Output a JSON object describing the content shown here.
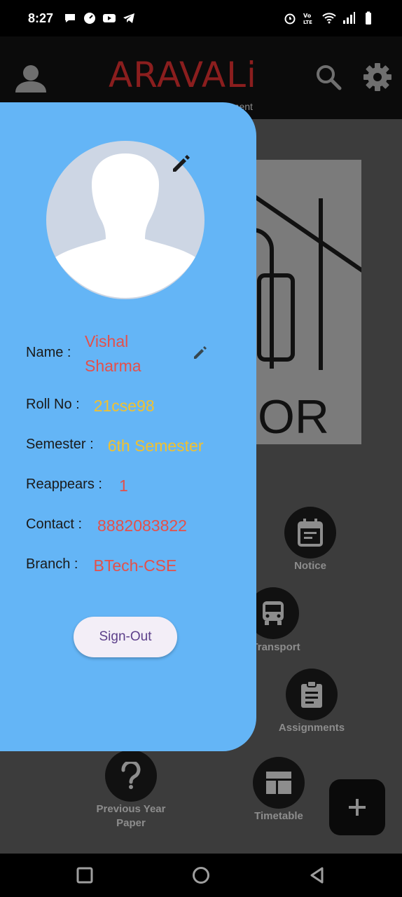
{
  "status_bar": {
    "time": "8:27",
    "left_icons": [
      "chat-bubble-icon",
      "speedometer-icon",
      "youtube-icon",
      "telegram-icon"
    ],
    "right_icons": [
      "alarm-icon",
      "volte-icon",
      "wifi-icon",
      "signal-icon",
      "battery-icon"
    ]
  },
  "app_bar": {
    "title": "ARAVALi",
    "subtitle": "ement",
    "title_color": "#8b1e1e"
  },
  "drawer": {
    "background": "#64b5f6",
    "fields": {
      "name_label": "Name :",
      "name_value": "Vishal Sharma",
      "roll_label": "Roll No :",
      "roll_value": "21cse98",
      "semester_label": "Semester :",
      "semester_value": "6th Semester",
      "reappears_label": "Reappears :",
      "reappears_value": "1",
      "contact_label": "Contact :",
      "contact_value": "8882083822",
      "branch_label": "Branch :",
      "branch_value": "BTech-CSE"
    },
    "signout_label": "Sign-Out"
  },
  "banner": {
    "text": "OR"
  },
  "grid": {
    "notice_label": "Notice",
    "transport_label": "Transport",
    "assignments_label": "Assignments",
    "pyq_label_line1": "Previous Year",
    "pyq_label_line2": "Paper",
    "timetable_label": "Timetable"
  },
  "fab": {
    "label": "+"
  }
}
